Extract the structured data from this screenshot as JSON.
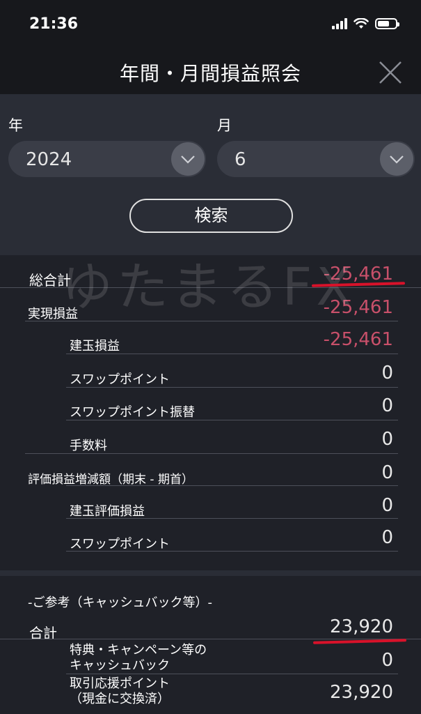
{
  "status_bar": {
    "time": "21:36"
  },
  "header": {
    "title": "年間・月間損益照会"
  },
  "filters": {
    "year_label": "年",
    "year_value": "2024",
    "month_label": "月",
    "month_value": "6",
    "search_label": "検索"
  },
  "watermark": "ゆたまるFX",
  "summary": {
    "total_label": "総合計",
    "total_value": "-25,461",
    "rows": [
      {
        "label": "実現損益",
        "value": "-25,461"
      },
      {
        "label": "建玉損益",
        "value": "-25,461"
      },
      {
        "label": "スワップポイント",
        "value": "0"
      },
      {
        "label": "スワップポイント振替",
        "value": "0"
      },
      {
        "label": "手数料",
        "value": "0"
      },
      {
        "label": "評価損益増減額（期末 - 期首）",
        "value": "0"
      },
      {
        "label": "建玉評価損益",
        "value": "0"
      },
      {
        "label": "スワップポイント",
        "value": "0"
      }
    ]
  },
  "reference": {
    "title": "-ご参考（キャッシュバック等）-",
    "total_label": "合計",
    "total_value": "23,920",
    "rows": [
      {
        "label_line1": "特典・キャンペーン等の",
        "label_line2": "キャッシュバック",
        "value": "0"
      },
      {
        "label_line1": "取引応援ポイント",
        "label_line2": "（現金に交換済）",
        "value": "23,920"
      }
    ]
  },
  "colors": {
    "negative": "#c8506a",
    "annotation_red": "#d8122a",
    "background": "#2a2d36"
  }
}
